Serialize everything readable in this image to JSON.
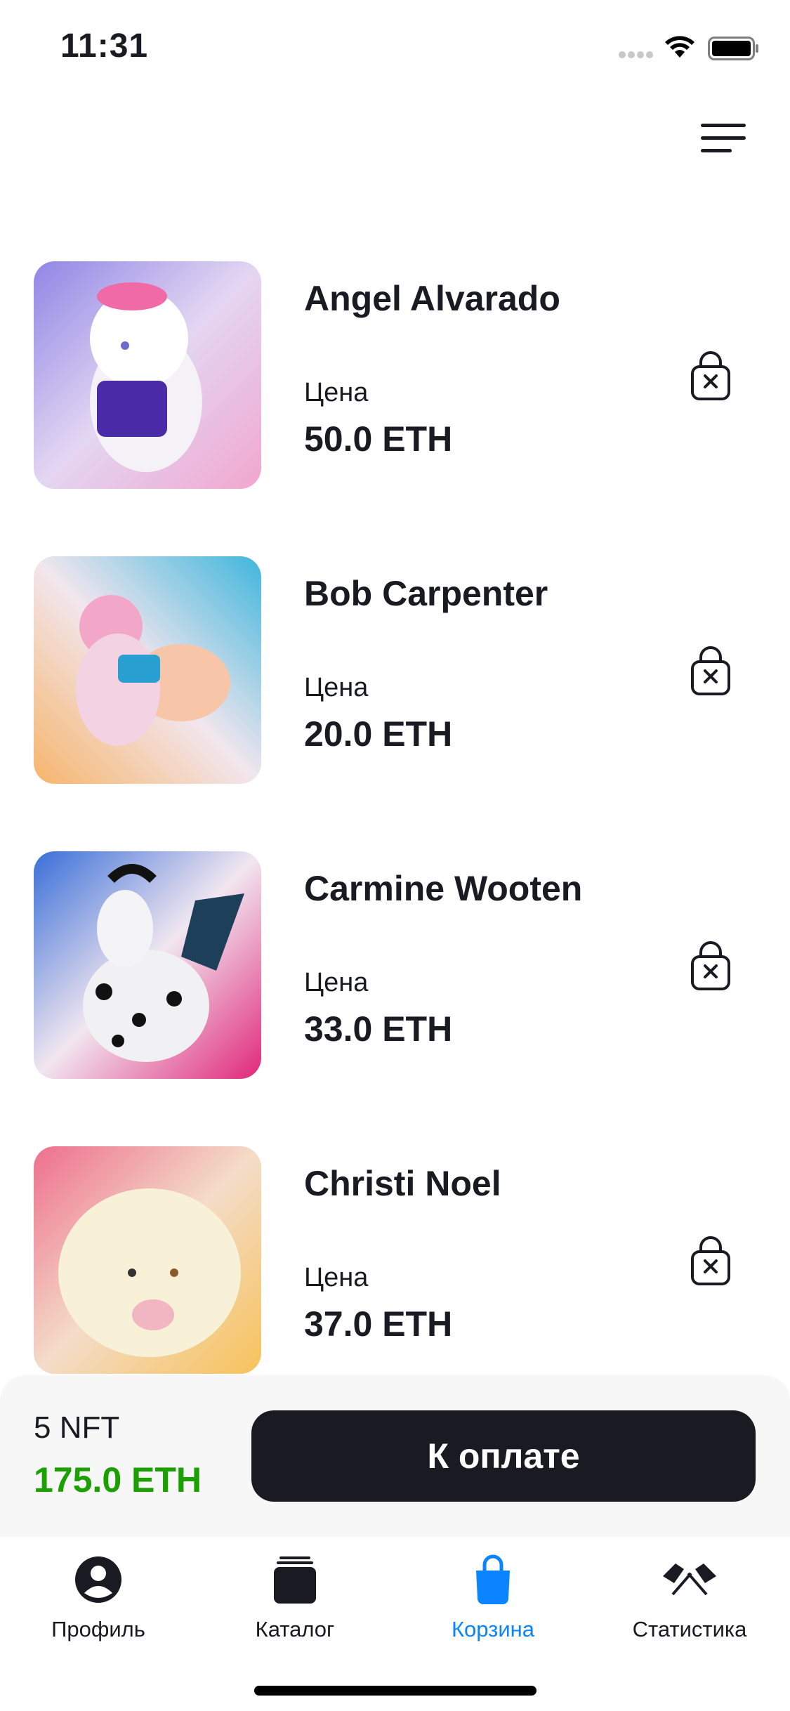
{
  "status_bar": {
    "time": "11:31"
  },
  "cart": {
    "items": [
      {
        "name": "Angel Alvarado",
        "price_label": "Цена",
        "price": "50.0 ETH"
      },
      {
        "name": "Bob Carpenter",
        "price_label": "Цена",
        "price": "20.0 ETH"
      },
      {
        "name": "Carmine Wooten",
        "price_label": "Цена",
        "price": "33.0 ETH"
      },
      {
        "name": "Christi Noel",
        "price_label": "Цена",
        "price": "37.0 ETH"
      }
    ]
  },
  "summary": {
    "count": "5 NFT",
    "total": "175.0 ETH",
    "pay_label": "К оплате"
  },
  "tabbar": {
    "tabs": [
      {
        "label": "Профиль",
        "icon": "profile-icon"
      },
      {
        "label": "Каталог",
        "icon": "catalog-icon"
      },
      {
        "label": "Корзина",
        "icon": "cart-icon",
        "active": true
      },
      {
        "label": "Статистика",
        "icon": "statistics-icon"
      }
    ]
  },
  "colors": {
    "accent": "#0a84ff",
    "total_green": "#1c9f00",
    "dark": "#1a1b22"
  }
}
